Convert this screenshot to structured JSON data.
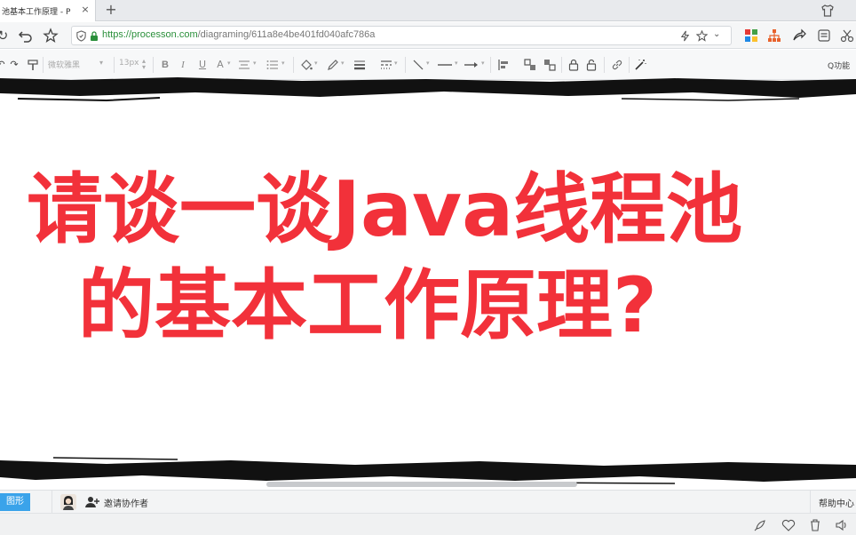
{
  "browser": {
    "tab_title": "池基本工作原理 - P",
    "tab_close": "×",
    "new_tab": "+",
    "url_scheme_host": "https://processon.com",
    "url_path": "/diagraming/611a8e4be401fd040afc786a"
  },
  "editor": {
    "font_family": "微软雅黑",
    "font_size": "13px",
    "search_label": "Q功能"
  },
  "canvas": {
    "headline_line1": "请谈一谈Java线程池",
    "headline_line2": "的基本工作原理?",
    "headline_color": "#f2313a"
  },
  "statusbar": {
    "shapes_button": "图形",
    "invite_label": "邀请协作者",
    "help_label": "帮助中心"
  },
  "colors": {
    "accent_blue": "#3aa3ea",
    "secure_green": "#2a8f3a"
  }
}
